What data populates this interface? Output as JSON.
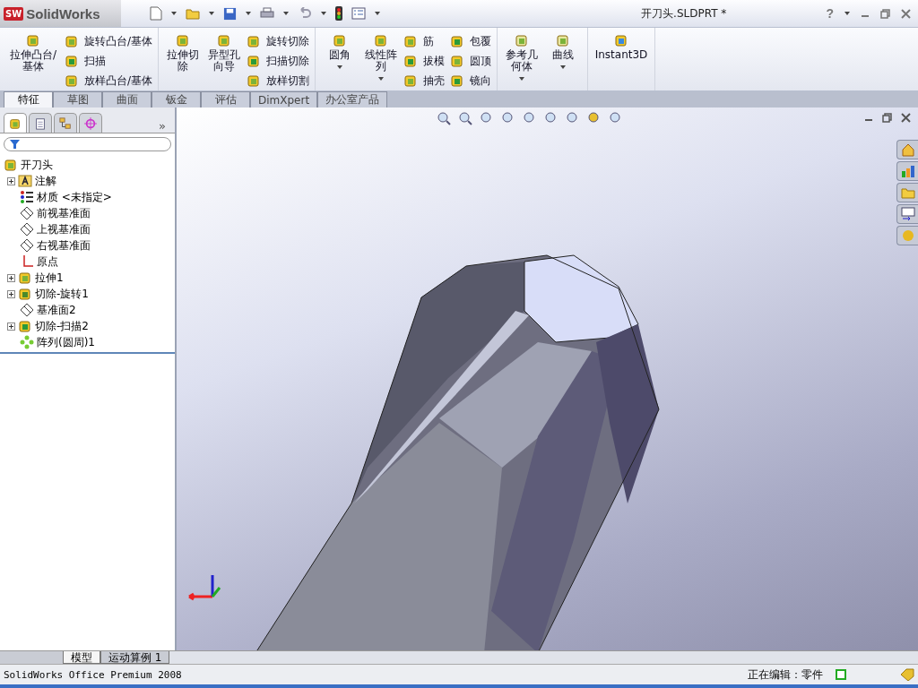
{
  "title_bar": {
    "logo_mark": "SW",
    "logo": "SolidWorks",
    "document_title": "开刀头.SLDPRT *",
    "help": "?"
  },
  "ribbon": {
    "groups": [
      {
        "large": [
          {
            "label": "拉伸凸台/基体",
            "has_menu": false
          }
        ],
        "small": [
          "旋转凸台/基体",
          "扫描",
          "放样凸台/基体"
        ]
      },
      {
        "large": [
          {
            "label": "拉伸切除",
            "has_menu": false
          },
          {
            "label": "异型孔向导",
            "has_menu": false
          }
        ],
        "small": [
          "旋转切除",
          "扫描切除",
          "放样切割"
        ]
      },
      {
        "large": [
          {
            "label": "圆角",
            "has_menu": true
          },
          {
            "label": "线性阵列",
            "has_menu": true
          }
        ],
        "small": [
          "筋",
          "拔模",
          "抽壳",
          "包覆",
          "圆顶",
          "镜向"
        ]
      },
      {
        "large": [
          {
            "label": "参考几何体",
            "has_menu": true
          },
          {
            "label": "曲线",
            "has_menu": true
          }
        ]
      },
      {
        "large": [
          {
            "label": "Instant3D",
            "has_menu": false
          }
        ]
      }
    ]
  },
  "command_tabs": [
    {
      "label": "特征",
      "selected": true
    },
    {
      "label": "草图",
      "selected": false
    },
    {
      "label": "曲面",
      "selected": false
    },
    {
      "label": "钣金",
      "selected": false
    },
    {
      "label": "评估",
      "selected": false
    },
    {
      "label": "DimXpert",
      "selected": false
    },
    {
      "label": "办公室产品",
      "selected": false
    }
  ],
  "feature_tree": {
    "more": "»",
    "panel_tabs": [
      {
        "kind": "feature",
        "selected": true
      },
      {
        "kind": "property",
        "selected": false
      },
      {
        "kind": "config",
        "selected": false
      },
      {
        "kind": "target",
        "selected": false
      }
    ],
    "root": {
      "label": "开刀头",
      "kind": "part",
      "children": [
        {
          "label": "注解",
          "kind": "annotation",
          "expandable": true,
          "expanded": false
        },
        {
          "label": "材质 <未指定>",
          "kind": "material",
          "expandable": false
        },
        {
          "label": "前视基准面",
          "kind": "plane",
          "expandable": false
        },
        {
          "label": "上视基准面",
          "kind": "plane",
          "expandable": false
        },
        {
          "label": "右视基准面",
          "kind": "plane",
          "expandable": false
        },
        {
          "label": "原点",
          "kind": "origin",
          "expandable": false
        },
        {
          "label": "拉伸1",
          "kind": "extrude",
          "expandable": true,
          "expanded": false
        },
        {
          "label": "切除-旋转1",
          "kind": "revolve",
          "expandable": true,
          "expanded": false
        },
        {
          "label": "基准面2",
          "kind": "plane",
          "expandable": false
        },
        {
          "label": "切除-扫描2",
          "kind": "sweep",
          "expandable": true,
          "expanded": false
        },
        {
          "label": "阵列(圆周)1",
          "kind": "pattern",
          "expandable": false
        }
      ]
    }
  },
  "bottom_tabs": [
    {
      "label": "模型",
      "selected": true
    },
    {
      "label": "运动算例 1",
      "selected": false
    }
  ],
  "status_bar": {
    "product": "SolidWorks Office Premium 2008",
    "mode": "正在编辑：零件"
  }
}
